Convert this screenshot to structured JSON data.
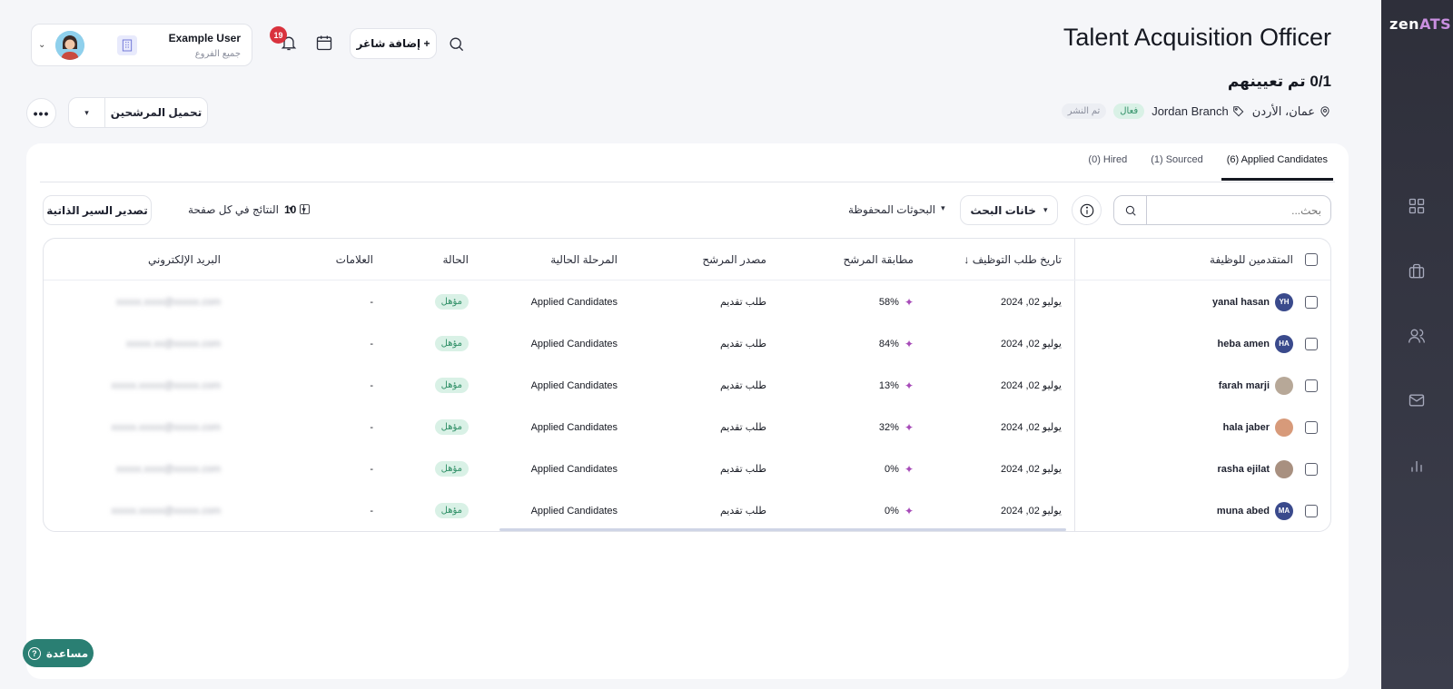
{
  "app": {
    "logo_main": "zen",
    "logo_accent": "ATS"
  },
  "header": {
    "title": "Talent Acquisition Officer",
    "hired_count": "0/1 تم تعيينهم",
    "location": "عمان، الأردن",
    "branch": "Jordan Branch",
    "status_active": "فعال",
    "status_published": "تم النشر"
  },
  "user": {
    "name": "Example User",
    "subtitle": "جميع الفروع"
  },
  "notifications": {
    "count": "19"
  },
  "toolbar": {
    "add_job_label": "+ إضافة شاغر",
    "upload_candidates_label": "تحميل المرشحين",
    "more_label": "•••"
  },
  "tabs": [
    {
      "label": "(6) Applied Candidates"
    },
    {
      "label": "(1) Sourced"
    },
    {
      "label": "(0) Hired"
    }
  ],
  "filters": {
    "search_placeholder": "بحث...",
    "search_fields_label": "خانات البحث",
    "saved_searches_label": "البحوثات المحفوظة",
    "per_page_label": "النتائج في كل صفحة",
    "per_page_value": "10",
    "export_label": "تصدير السير الذاتية"
  },
  "table": {
    "columns": {
      "candidates": "المتقدمين للوظيفة",
      "applied_date": "تاريخ طلب التوظيف ↓",
      "match": "مطابقة المرشح",
      "source": "مصدر المرشح",
      "stage": "المرحلة الحالية",
      "status": "الحالة",
      "tags": "العلامات",
      "email": "البريد الإلكتروني"
    },
    "rows": [
      {
        "initials": "YH",
        "name": "yanal hasan",
        "date": "يوليو 02, 2024",
        "match": "58%",
        "source": "طلب تقديم",
        "stage": "Applied Candidates",
        "status": "مؤهل",
        "tags": "-",
        "email": "xxxxx.xxxx@xxxxx.com"
      },
      {
        "initials": "HA",
        "name": "heba amen",
        "date": "يوليو 02, 2024",
        "match": "84%",
        "source": "طلب تقديم",
        "stage": "Applied Candidates",
        "status": "مؤهل",
        "tags": "-",
        "email": "xxxxx.xx@xxxxx.com"
      },
      {
        "initials": "",
        "name": "farah marji",
        "date": "يوليو 02, 2024",
        "match": "13%",
        "source": "طلب تقديم",
        "stage": "Applied Candidates",
        "status": "مؤهل",
        "tags": "-",
        "email": "xxxxx.xxxxx@xxxxx.com"
      },
      {
        "initials": "",
        "name": "hala jaber",
        "date": "يوليو 02, 2024",
        "match": "32%",
        "source": "طلب تقديم",
        "stage": "Applied Candidates",
        "status": "مؤهل",
        "tags": "-",
        "email": "xxxxx.xxxxx@xxxxx.com"
      },
      {
        "initials": "",
        "name": "rasha ejilat",
        "date": "يوليو 02, 2024",
        "match": "0%",
        "source": "طلب تقديم",
        "stage": "Applied Candidates",
        "status": "مؤهل",
        "tags": "-",
        "email": "xxxxx.xxxx@xxxxx.com"
      },
      {
        "initials": "MA",
        "name": "muna abed",
        "date": "يوليو 02, 2024",
        "match": "0%",
        "source": "طلب تقديم",
        "stage": "Applied Candidates",
        "status": "مؤهل",
        "tags": "-",
        "email": "xxxxx.xxxxx@xxxxx.com"
      }
    ]
  },
  "help": {
    "label": "مساعدة",
    "icon_glyph": "?"
  }
}
